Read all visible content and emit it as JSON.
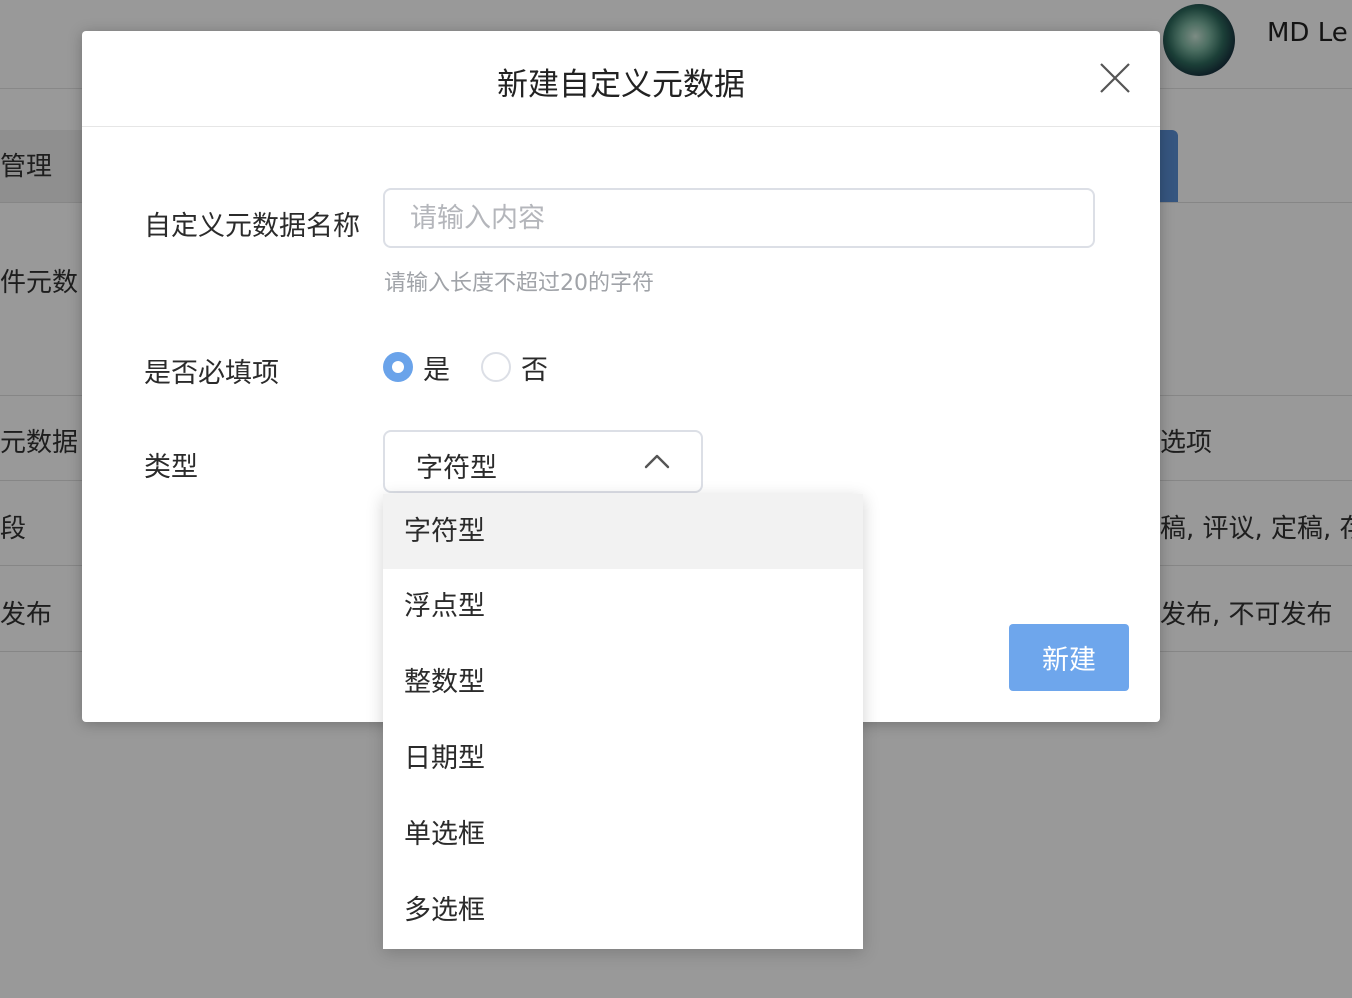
{
  "background": {
    "user_name": "MD Le",
    "nav_active_label": "管理",
    "row_texts": [
      "件元数",
      "元数据",
      "段",
      "发布"
    ],
    "right_texts": [
      "选项",
      "稿, 评议, 定稿, 存",
      "发布, 不可发布"
    ]
  },
  "dialog": {
    "title": "新建自定义元数据",
    "name_label": "自定义元数据名称",
    "name_value": "",
    "name_placeholder": "请输入内容",
    "name_hint": "请输入长度不超过20的字符",
    "required_label": "是否必填项",
    "required_options": [
      {
        "label": "是",
        "checked": true
      },
      {
        "label": "否",
        "checked": false
      }
    ],
    "type_label": "类型",
    "type_value": "字符型",
    "create_label": "新建"
  },
  "dropdown": {
    "options": [
      "字符型",
      "浮点型",
      "整数型",
      "日期型",
      "单选框",
      "多选框"
    ],
    "highlighted": "字符型"
  },
  "colors": {
    "primary": "#6ea6ec",
    "radio_checked": "#6aa3ea",
    "overlay": "rgba(0,0,0,0.40)"
  },
  "icons": {
    "close": "close-icon",
    "type_dropdown": "chevron-up-icon",
    "avatar": "avatar-image"
  }
}
